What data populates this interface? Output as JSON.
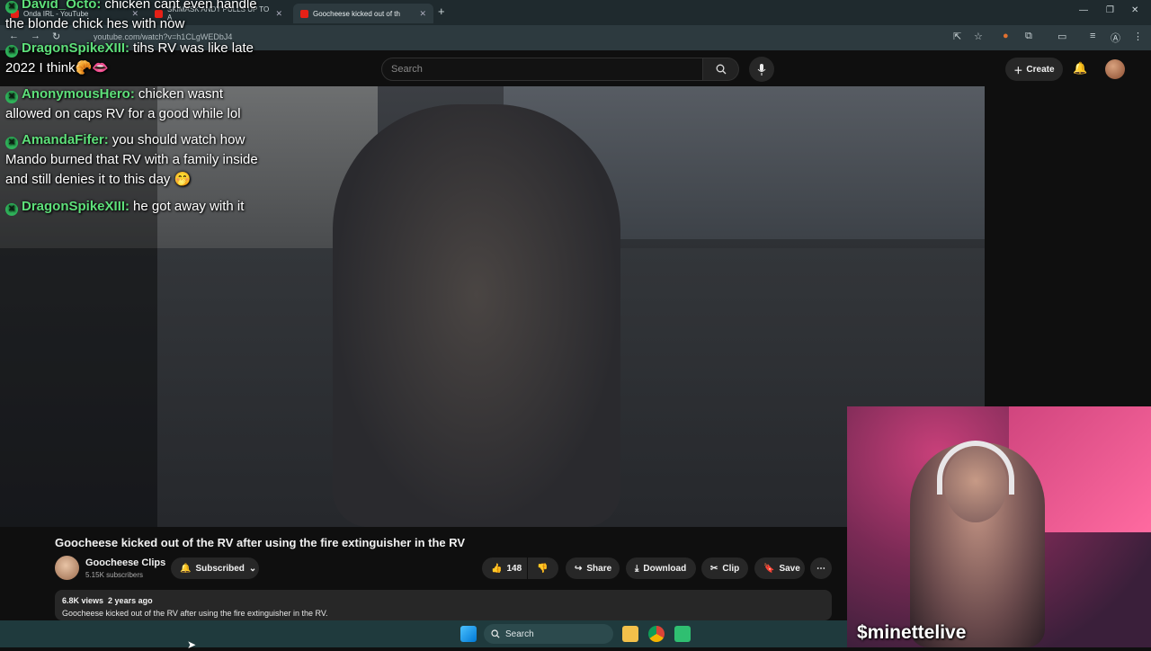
{
  "browser": {
    "tabs": [
      {
        "label": "Onda IRL - YouTube",
        "active": false
      },
      {
        "label": "SKIMASK ANDY PULLS UP TO A",
        "active": false
      },
      {
        "label": "Goocheese kicked out of th",
        "active": true
      }
    ],
    "url": "youtube.com/watch?v=h1CLgWEDbJ4"
  },
  "youtube": {
    "search_placeholder": "Search",
    "create_label": "Create",
    "video_title": "Goocheese kicked out of the RV after using the fire extinguisher in the RV",
    "channel": {
      "name": "Goocheese Clips",
      "subscribers": "5.15K subscribers"
    },
    "subscribed_label": "Subscribed",
    "actions": {
      "likes": "148",
      "share": "Share",
      "download": "Download",
      "clip": "Clip",
      "save": "Save"
    },
    "description": {
      "views": "6.8K views",
      "age": "2 years ago",
      "text": "Goocheese kicked out of the RV after using the fire extinguisher in the RV."
    }
  },
  "chat": [
    {
      "user": "David_Octo",
      "line1": "chicken cant even handle",
      "line2": "the blonde chick hes with now",
      "line3": ""
    },
    {
      "user": "DragonSpikeXIII",
      "line1": "tihs RV was like late",
      "line2": "2022 I think🥐👄",
      "line3": ""
    },
    {
      "user": "AnonymousHero",
      "line1": "chicken wasnt",
      "line2": "allowed on caps RV for a good while lol",
      "line3": ""
    },
    {
      "user": "AmandaFifer",
      "line1": "you should watch how",
      "line2": "Mando burned that RV with a family inside",
      "line3": "and still denies it to this day 🤭"
    },
    {
      "user": "DragonSpikeXIII",
      "line1": "he got away with it",
      "line2": "",
      "line3": ""
    }
  ],
  "webcam": {
    "handle": "$minettelive"
  },
  "taskbar": {
    "search_label": "Search"
  }
}
